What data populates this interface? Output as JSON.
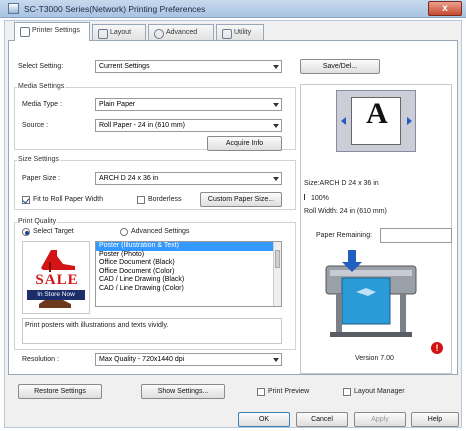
{
  "window": {
    "title": "SC-T3000 Series(Network) Printing Preferences",
    "close": "x"
  },
  "tabs": [
    {
      "label": "Printer Settings"
    },
    {
      "label": "Layout"
    },
    {
      "label": "Advanced"
    },
    {
      "label": "Utility"
    }
  ],
  "select_setting": {
    "label": "Select Setting:",
    "value": "Current Settings",
    "save_button": "Save/Del..."
  },
  "media_settings": {
    "title": "Media Settings",
    "media_type_label": "Media Type :",
    "media_type_value": "Plain Paper",
    "source_label": "Source :",
    "source_value": "Roll Paper - 24 in (610 mm)",
    "acquire_button": "Acquire Info"
  },
  "size_settings": {
    "title": "Size Settings",
    "paper_size_label": "Paper Size :",
    "paper_size_value": "ARCH D 24 x 36 in",
    "fit_roll_label": "Fit to Roll Paper Width",
    "fit_roll_checked": true,
    "borderless_label": "Borderless",
    "borderless_checked": false,
    "custom_button": "Custom Paper Size..."
  },
  "print_quality": {
    "title": "Print Quality",
    "select_target_label": "Select Target",
    "advanced_label": "Advanced Settings",
    "sale_text": "SALE",
    "store_text": "In Store Now",
    "targets": [
      "Poster (Illustration & Text)",
      "Poster (Photo)",
      "Office Document (Black)",
      "Office Document (Color)",
      "CAD / Line Drawing (Black)",
      "CAD / Line Drawing (Color)"
    ],
    "selected_index": 0,
    "description": "Print posters with illustrations and texts vividly.",
    "resolution_label": "Resolution :",
    "resolution_value": "Max Quality - 720x1440 dpi"
  },
  "preview": {
    "letter": "A",
    "size_text": "Size:ARCH D 24 x 36 in",
    "scale_text": "100%",
    "roll_width_text": "Roll Width: 24 in (610 mm)",
    "paper_remaining_label": "Paper Remaining:",
    "version": "Version 7.00"
  },
  "bottom": {
    "restore_button": "Restore Settings",
    "show_button": "Show Settings...",
    "print_preview_label": "Print Preview",
    "layout_manager_label": "Layout Manager",
    "ok": "OK",
    "cancel": "Cancel",
    "apply": "Apply",
    "help": "Help"
  },
  "colors": {
    "selection": "#3399ff",
    "title_gradient_top": "#c7d9ee",
    "alert_red": "#d41010"
  }
}
